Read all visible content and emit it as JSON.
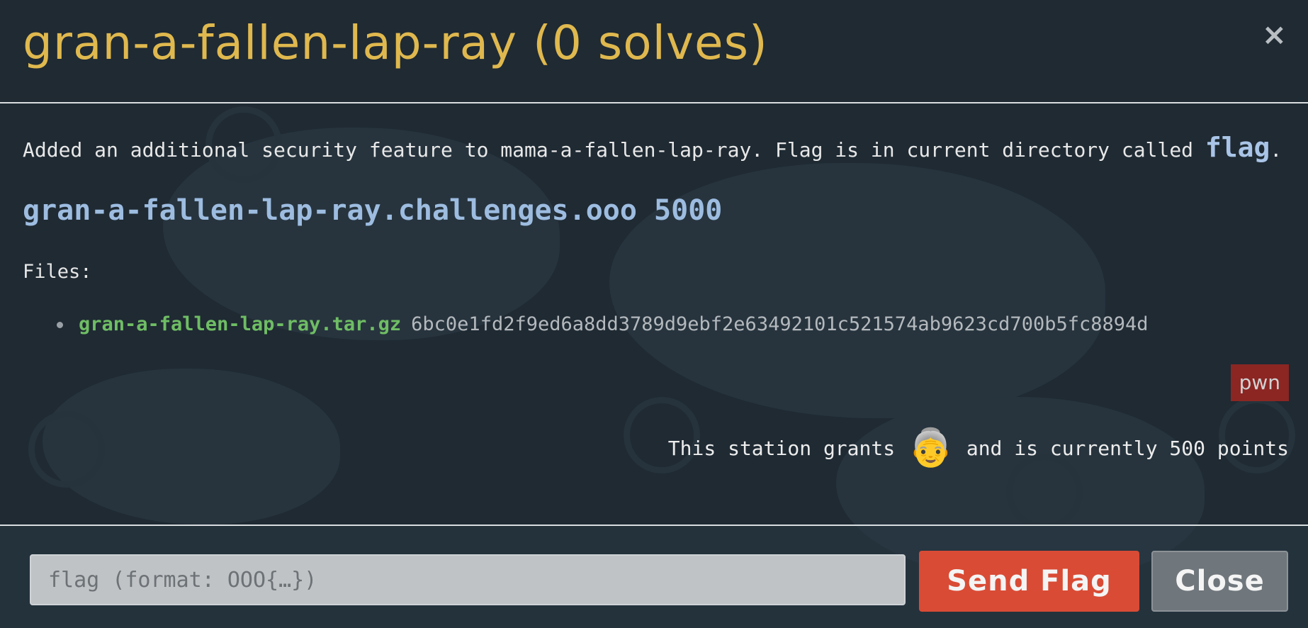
{
  "modal": {
    "title": "gran-a-fallen-lap-ray (0 solves)",
    "close_symbol": "×"
  },
  "challenge": {
    "description_prefix": "Added an additional security feature to mama-a-fallen-lap-ray. Flag is in current directory called ",
    "description_code": "flag",
    "description_suffix": ".",
    "endpoint": "gran-a-fallen-lap-ray.challenges.ooo 5000",
    "files_label": "Files:",
    "files": [
      {
        "name": "gran-a-fallen-lap-ray.tar.gz",
        "hash": "6bc0e1fd2f9ed6a8dd3789d9ebf2e63492101c521574ab9623cd700b5fc8894d"
      }
    ],
    "tag": "pwn",
    "grants_prefix": "This station grants",
    "grants_emoji": "👵",
    "grants_suffix": "and is currently 500 points"
  },
  "footer": {
    "flag_placeholder": "flag (format: OOO{…})",
    "send_label": "Send Flag",
    "close_label": "Close"
  },
  "colors": {
    "title": "#dfb84e",
    "endpoint": "#9dbce0",
    "file_link": "#6fbd64",
    "tag_bg": "#8b2623",
    "send_button": "#d94b35",
    "close_button": "#6f767c"
  },
  "icons": {
    "close": "close-icon",
    "bullet": "bullet-icon",
    "grant": "grandmother-emoji-icon"
  }
}
